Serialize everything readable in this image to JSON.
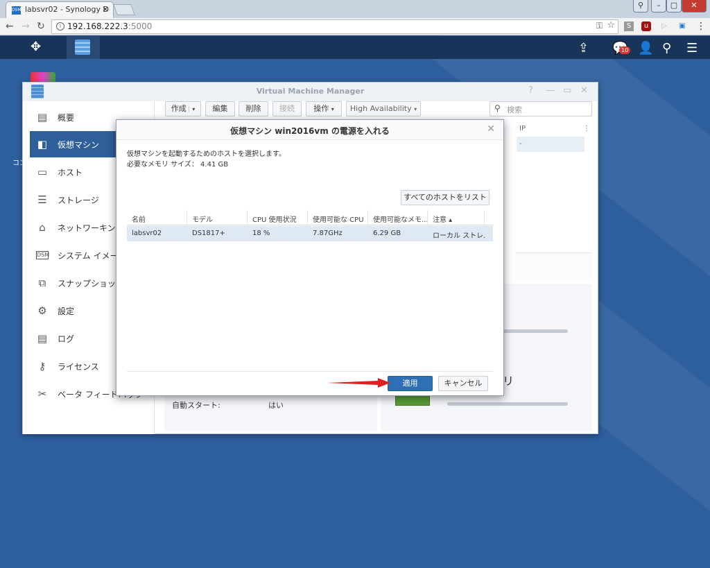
{
  "browser": {
    "tab_title": "labsvr02 - Synology D",
    "tab_close": "×",
    "favicon_text": "DSM",
    "url_host": "192.168.222.3",
    "url_port": ":5000",
    "win_controls": [
      "⚲",
      "–",
      "▢",
      "✕"
    ]
  },
  "dsm": {
    "notification_count": "10"
  },
  "desktop": {
    "left_label": "コン"
  },
  "vmm": {
    "title": "Virtual Machine Manager",
    "sidebar": [
      {
        "label": "概要",
        "icon": "overview-icon"
      },
      {
        "label": "仮想マシン",
        "icon": "vm-icon",
        "active": true
      },
      {
        "label": "ホスト",
        "icon": "host-icon"
      },
      {
        "label": "ストレージ",
        "icon": "storage-icon"
      },
      {
        "label": "ネットワーキング",
        "icon": "network-icon"
      },
      {
        "label": "システム イメージ",
        "icon": "image-icon"
      },
      {
        "label": "スナップショット",
        "icon": "snapshot-icon"
      },
      {
        "label": "設定",
        "icon": "gear-icon"
      },
      {
        "label": "ログ",
        "icon": "log-icon"
      },
      {
        "label": "ライセンス",
        "icon": "key-icon"
      },
      {
        "label": "ベータ フィードバック",
        "icon": "wrench-icon"
      }
    ],
    "toolbar": {
      "create": "作成",
      "edit": "編集",
      "delete": "削除",
      "connect": "接続",
      "action": "操作",
      "ha": "High Availability",
      "search_placeholder": "検索"
    },
    "ip_header": "IP",
    "ip_value": "-",
    "auto_start_label": "自動スタート:",
    "auto_start_value": "はい"
  },
  "modal": {
    "title": "仮想マシン win2016vm の電源を入れる",
    "desc1": "仮想マシンを起動するためのホストを選択します。",
    "desc2": "必要なメモリ サイズ： 4.41 GB",
    "list_all_button": "すべてのホストをリスト",
    "columns": [
      "名前",
      "モデル",
      "CPU 使用状況",
      "使用可能な CPU",
      "使用可能なメモ...",
      "注意 ▴"
    ],
    "row": [
      "labsvr02",
      "DS1817+",
      "18 %",
      "7.87GHz",
      "6.29 GB",
      "ローカル ストレ..."
    ],
    "apply": "適用",
    "cancel": "キャンセル"
  }
}
